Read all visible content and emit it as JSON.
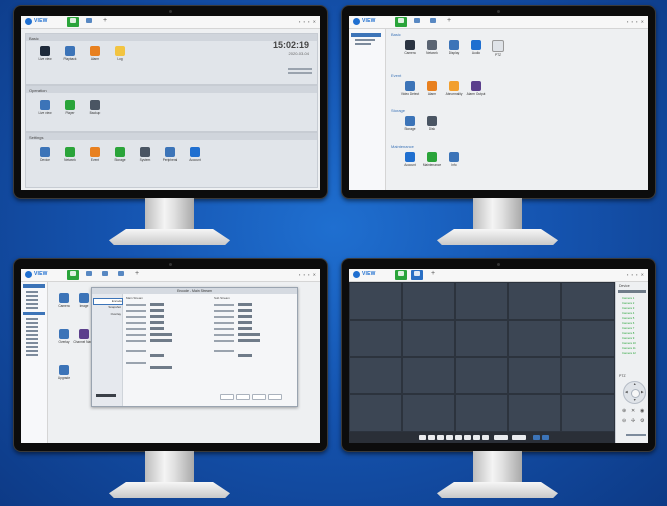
{
  "brand": {
    "logo_text": "VIEW"
  },
  "monitor1": {
    "clock": "15:02:19",
    "date": "2020-03-04",
    "panels": [
      "Basic",
      "Operation",
      "Settings"
    ],
    "basic_tiles": [
      "Live view",
      "Playback",
      "Alarm",
      "Log"
    ],
    "operation_tiles": [
      "Live view",
      "Player",
      "Backup"
    ],
    "settings_tiles": [
      "Device",
      "Network",
      "Event",
      "Storage",
      "System",
      "Peripheral",
      "Account"
    ]
  },
  "monitor2": {
    "sections": [
      "Basic",
      "Event",
      "Storage",
      "Maintenance"
    ],
    "row1": [
      "Camera",
      "Network",
      "Display",
      "Audio",
      "PTZ"
    ],
    "row2": [
      "Video Detect",
      "Alarm",
      "Abnormality",
      "Alarm Output"
    ],
    "row3": [
      "Storage",
      "Disk"
    ],
    "row4": [
      "Account",
      "Maintenance",
      "Info"
    ]
  },
  "monitor3": {
    "row1": [
      "Camera",
      "Image",
      "Encode"
    ],
    "row2": [
      "Overlay",
      "Channel Name"
    ],
    "row3": [
      "Upgrade"
    ],
    "dialog": {
      "title": "Encode - Main Stream",
      "side_items": [
        "Encode",
        "Snapshot",
        "Overlay"
      ],
      "left_head": "Main Stream",
      "right_head": "Sub Stream",
      "buttons": [
        "Default",
        "Apply",
        "Save",
        "Cancel"
      ]
    }
  },
  "monitor4": {
    "right_title": "Device",
    "cameras": [
      "Camera 1",
      "Camera 2",
      "Camera 3",
      "Camera 4",
      "Camera 5",
      "Camera 6",
      "Camera 7",
      "Camera 8",
      "Camera 9",
      "Camera 10",
      "Camera 11",
      "Camera 12"
    ],
    "ptz_label": "PTZ"
  },
  "colors": {
    "accent": "#1f6fd0",
    "active_tab": "#2aa43a",
    "video_bg": "#3c4654"
  }
}
